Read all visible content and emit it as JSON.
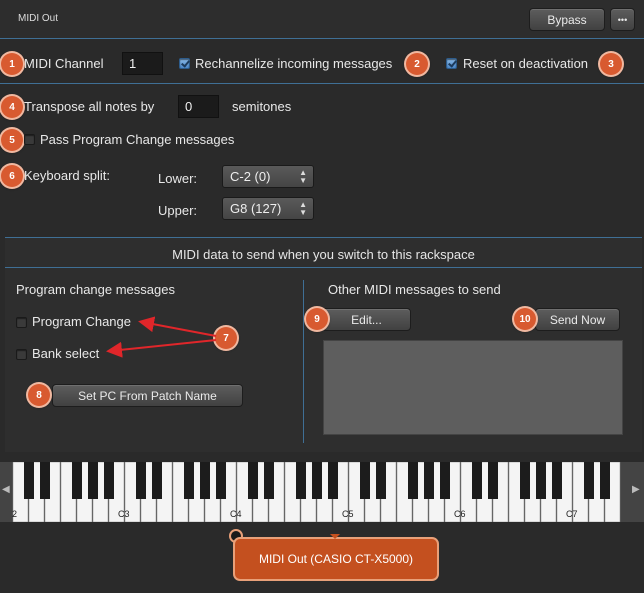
{
  "header": {
    "title": "MIDI Out",
    "bypass_label": "Bypass",
    "more_label": "•••"
  },
  "midi_channel": {
    "label": "MIDI Channel",
    "value": "1"
  },
  "rechannelize": {
    "label": "Rechannelize incoming messages",
    "checked": true
  },
  "reset_deactivation": {
    "label": "Reset on deactivation",
    "checked": true
  },
  "transpose": {
    "label": "Transpose all notes by",
    "value": "0",
    "unit": "semitones"
  },
  "pass_pc": {
    "label": "Pass Program Change messages",
    "checked": false
  },
  "split": {
    "label": "Keyboard split:",
    "lower_label": "Lower:",
    "lower_value": "C-2 (0)",
    "upper_label": "Upper:",
    "upper_value": "G8 (127)"
  },
  "panel": {
    "title": "MIDI data to send when you switch to this rackspace",
    "pc_heading": "Program change messages",
    "program_change_label": "Program Change",
    "bank_select_label": "Bank select",
    "set_pc_label": "Set PC From Patch Name",
    "other_heading": "Other MIDI messages to send",
    "edit_label": "Edit...",
    "send_now_label": "Send Now"
  },
  "keyboard": {
    "octave_labels": [
      "C3",
      "C4",
      "C5",
      "C6",
      "C7"
    ],
    "left_arrow": "◀",
    "right_arrow": "▶",
    "partial_label": "2"
  },
  "footer": {
    "device_label": "MIDI Out (CASIO CT-X5000)"
  },
  "badges": [
    "1",
    "2",
    "3",
    "4",
    "5",
    "6",
    "7",
    "8",
    "9",
    "10"
  ],
  "colors": {
    "accent": "#d85a30",
    "separator": "#3f6f95",
    "device": "#c4501f",
    "arrow": "#e0262a"
  }
}
